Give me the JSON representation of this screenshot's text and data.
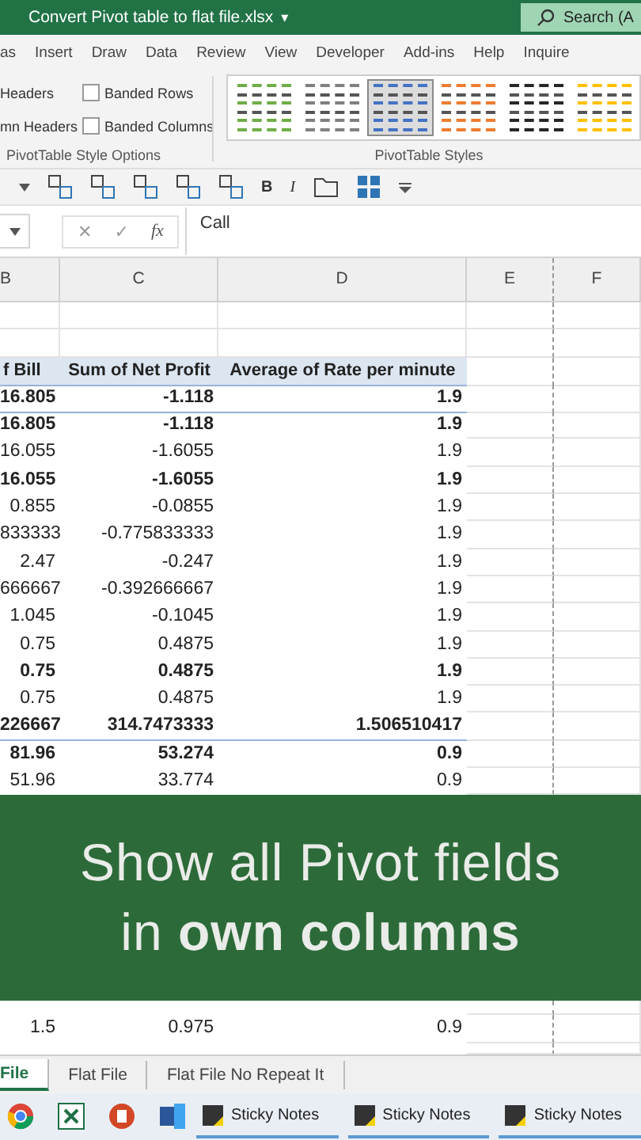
{
  "window": {
    "title": "Convert Pivot table to flat file.xlsx",
    "title_caret": "▾",
    "search": {
      "placeholder": "Search (A"
    }
  },
  "ribbon_tabs": [
    {
      "label": "as",
      "selected": false
    },
    {
      "label": "Insert",
      "selected": false
    },
    {
      "label": "Draw",
      "selected": false
    },
    {
      "label": "Data",
      "selected": false
    },
    {
      "label": "Review",
      "selected": false
    },
    {
      "label": "View",
      "selected": false
    },
    {
      "label": "Developer",
      "selected": false
    },
    {
      "label": "Add-ins",
      "selected": false
    },
    {
      "label": "Help",
      "selected": false
    },
    {
      "label": "Inquire",
      "selected": false
    }
  ],
  "style_options": {
    "label": "PivotTable Style Options",
    "options": [
      {
        "label": "Headers",
        "kind": "text"
      },
      {
        "label": "Banded Rows",
        "kind": "checkbox",
        "checked": false
      },
      {
        "label": "mn Headers",
        "kind": "text"
      },
      {
        "label": "Banded Columns",
        "kind": "checkbox",
        "checked": false
      }
    ]
  },
  "pivot_styles": {
    "label": "PivotTable Styles",
    "styles": [
      {
        "color": "#70ad47",
        "selected": false
      },
      {
        "color": "#808080",
        "selected": false
      },
      {
        "color": "#4472c4",
        "selected": true
      },
      {
        "color": "#ed7d31",
        "selected": false
      },
      {
        "color": "#262626",
        "selected": false
      },
      {
        "color": "#ffc000",
        "selected": false
      }
    ]
  },
  "toolbar": [
    {
      "kind": "caret"
    },
    {
      "kind": "icon"
    },
    {
      "kind": "icon"
    },
    {
      "kind": "icon"
    },
    {
      "kind": "icon"
    },
    {
      "kind": "icon"
    },
    {
      "kind": "glyph",
      "label": "B"
    },
    {
      "kind": "glyph",
      "label": "I"
    },
    {
      "kind": "folder"
    },
    {
      "kind": "grid"
    },
    {
      "kind": "more"
    }
  ],
  "formula_bar": {
    "cancel": "✕",
    "enter": "✓",
    "fx": "fx",
    "value": "Call"
  },
  "sheet": {
    "columns": [
      "B",
      "C",
      "D",
      "E",
      "F"
    ],
    "header": [
      "f Bill",
      "Sum of Net Profit",
      "Average of Rate per minute"
    ],
    "rows": [
      {
        "cells": [
          "16.805",
          "-1.118",
          "1.9"
        ],
        "bold": true,
        "rule_below": true
      },
      {
        "cells": [
          "16.805",
          "-1.118",
          "1.9"
        ],
        "bold": true,
        "rule_below": false
      },
      {
        "cells": [
          "16.055",
          "-1.6055",
          "1.9"
        ],
        "bold": false,
        "rule_below": false
      },
      {
        "cells": [
          "16.055",
          "-1.6055",
          "1.9"
        ],
        "bold": true,
        "rule_below": false
      },
      {
        "cells": [
          "0.855",
          "-0.0855",
          "1.9"
        ],
        "bold": false,
        "rule_below": false
      },
      {
        "cells": [
          "833333",
          "-0.775833333",
          "1.9"
        ],
        "bold": false,
        "rule_below": false
      },
      {
        "cells": [
          "2.47",
          "-0.247",
          "1.9"
        ],
        "bold": false,
        "rule_below": false
      },
      {
        "cells": [
          "666667",
          "-0.392666667",
          "1.9"
        ],
        "bold": false,
        "rule_below": false
      },
      {
        "cells": [
          "1.045",
          "-0.1045",
          "1.9"
        ],
        "bold": false,
        "rule_below": false
      },
      {
        "cells": [
          "0.75",
          "0.4875",
          "1.9"
        ],
        "bold": false,
        "rule_below": false
      },
      {
        "cells": [
          "0.75",
          "0.4875",
          "1.9"
        ],
        "bold": true,
        "rule_below": false
      },
      {
        "cells": [
          "0.75",
          "0.4875",
          "1.9"
        ],
        "bold": false,
        "rule_below": false
      },
      {
        "cells": [
          "226667",
          "314.7473333",
          "1.506510417"
        ],
        "bold": true,
        "rule_below": true
      },
      {
        "cells": [
          "81.96",
          "53.274",
          "0.9"
        ],
        "bold": true,
        "rule_below": false
      },
      {
        "cells": [
          "51.96",
          "33.774",
          "0.9"
        ],
        "bold": false,
        "rule_below": false
      }
    ],
    "rows_below": [
      {
        "cells": [
          "1.5",
          "0.975",
          "0.9"
        ],
        "bold": false,
        "rule_below": false
      }
    ]
  },
  "banner": {
    "line_1": "Show all Pivot fields",
    "line_2": "in **own columns**"
  },
  "sheet_tabs": [
    {
      "label": "File",
      "selected": true
    },
    {
      "label": "Flat File",
      "selected": false
    },
    {
      "label": "Flat File No Repeat It",
      "selected": false
    }
  ],
  "taskbar": {
    "apps": [
      {
        "kind": "browser"
      },
      {
        "kind": "spreadsheet"
      },
      {
        "kind": "slides"
      },
      {
        "kind": "document"
      }
    ],
    "windows": [
      {
        "label": "Sticky Notes"
      },
      {
        "label": "Sticky Notes"
      },
      {
        "label": "Sticky Notes"
      }
    ]
  }
}
